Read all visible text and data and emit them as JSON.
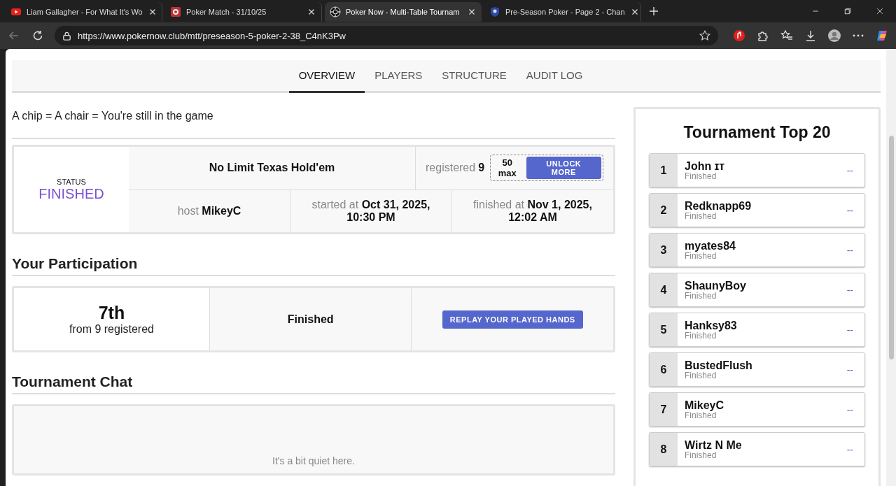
{
  "browser": {
    "tabs": [
      {
        "title": "Liam Gallagher - For What It's Wo",
        "selected": false
      },
      {
        "title": "Poker Match - 31/10/25",
        "selected": false
      },
      {
        "title": "Poker Now - Multi-Table Tournam",
        "selected": true
      },
      {
        "title": "Pre-Season Poker - Page 2 - Chan",
        "selected": false
      }
    ],
    "address": "https://www.pokernow.club/mtt/preseason-5-poker-2-38_C4nK3Pw"
  },
  "nav_tabs": [
    {
      "label": "OVERVIEW",
      "selected": true
    },
    {
      "label": "PLAYERS",
      "selected": false
    },
    {
      "label": "STRUCTURE",
      "selected": false
    },
    {
      "label": "AUDIT LOG",
      "selected": false
    }
  ],
  "tagline": "A chip = A chair = You're still in the game",
  "info": {
    "status_label": "STATUS",
    "status": "FINISHED",
    "game": "No Limit Texas Hold'em",
    "registered_label": "registered",
    "registered": "9",
    "max": "50 max",
    "unlock_button": "UNLOCK MORE",
    "host": "host **MikeyC**",
    "started": "started at **Oct 31, 2025, 10:30 PM**",
    "finished": "finished at **Nov 1, 2025, 12:02 AM**"
  },
  "participation": {
    "heading": "Your Participation",
    "place": "7th",
    "place_note": "from 9 registered",
    "status": "Finished",
    "replay_button": "REPLAY YOUR PLAYED HANDS"
  },
  "chat": {
    "heading": "Tournament Chat",
    "empty_text": "It's a bit quiet here."
  },
  "top20": {
    "title": "Tournament Top 20",
    "players": [
      {
        "rank": "1",
        "name": "John ɪт",
        "status": "Finished",
        "value": "--"
      },
      {
        "rank": "2",
        "name": "Redknapp69",
        "status": "Finished",
        "value": "--"
      },
      {
        "rank": "3",
        "name": "myates84",
        "status": "Finished",
        "value": "--"
      },
      {
        "rank": "4",
        "name": "ShaunyBoy",
        "status": "Finished",
        "value": "--"
      },
      {
        "rank": "5",
        "name": "Hanksy83",
        "status": "Finished",
        "value": "--"
      },
      {
        "rank": "6",
        "name": "BustedFlush",
        "status": "Finished",
        "value": "--"
      },
      {
        "rank": "7",
        "name": "MikeyC",
        "status": "Finished",
        "value": "--"
      },
      {
        "rank": "8",
        "name": "Wirtz N Me",
        "status": "Finished",
        "value": "--"
      }
    ]
  }
}
